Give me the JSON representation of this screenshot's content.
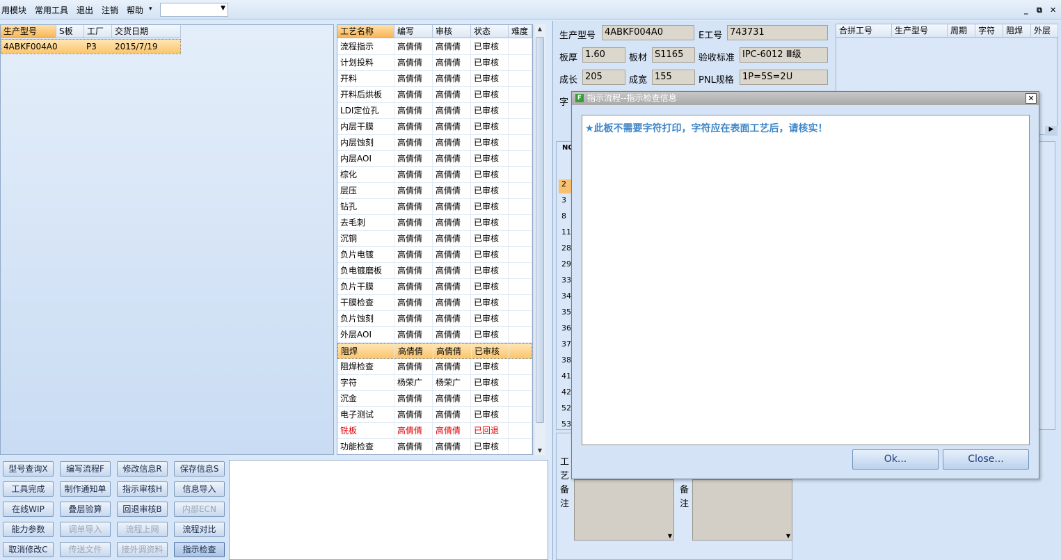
{
  "menubar": {
    "items": [
      "用模块",
      "常用工具",
      "退出",
      "注销",
      "帮助"
    ],
    "combo_value": "",
    "window_controls": [
      "_",
      "⧉",
      "✕"
    ]
  },
  "orders": {
    "columns": [
      "生产型号",
      "S板",
      "工厂",
      "交货日期"
    ],
    "rows": [
      {
        "model": "4ABKF004A0",
        "s": "",
        "factory": "P3",
        "date": "2015/7/19"
      }
    ]
  },
  "process": {
    "columns": [
      "工艺名称",
      "编写",
      "审核",
      "状态",
      "难度"
    ],
    "rows": [
      {
        "name": "流程指示",
        "writer": "高倩倩",
        "reviewer": "高倩倩",
        "status": "已审核"
      },
      {
        "name": "计划投料",
        "writer": "高倩倩",
        "reviewer": "高倩倩",
        "status": "已审核"
      },
      {
        "name": "开料",
        "writer": "高倩倩",
        "reviewer": "高倩倩",
        "status": "已审核"
      },
      {
        "name": "开料后烘板",
        "writer": "高倩倩",
        "reviewer": "高倩倩",
        "status": "已审核"
      },
      {
        "name": "LDI定位孔",
        "writer": "高倩倩",
        "reviewer": "高倩倩",
        "status": "已审核"
      },
      {
        "name": "内层干膜",
        "writer": "高倩倩",
        "reviewer": "高倩倩",
        "status": "已审核"
      },
      {
        "name": "内层蚀刻",
        "writer": "高倩倩",
        "reviewer": "高倩倩",
        "status": "已审核"
      },
      {
        "name": "内层AOI",
        "writer": "高倩倩",
        "reviewer": "高倩倩",
        "status": "已审核"
      },
      {
        "name": "棕化",
        "writer": "高倩倩",
        "reviewer": "高倩倩",
        "status": "已审核"
      },
      {
        "name": "层压",
        "writer": "高倩倩",
        "reviewer": "高倩倩",
        "status": "已审核"
      },
      {
        "name": "钻孔",
        "writer": "高倩倩",
        "reviewer": "高倩倩",
        "status": "已审核"
      },
      {
        "name": "去毛刺",
        "writer": "高倩倩",
        "reviewer": "高倩倩",
        "status": "已审核"
      },
      {
        "name": "沉铜",
        "writer": "高倩倩",
        "reviewer": "高倩倩",
        "status": "已审核"
      },
      {
        "name": "负片电镀",
        "writer": "高倩倩",
        "reviewer": "高倩倩",
        "status": "已审核"
      },
      {
        "name": "负电镀磨板",
        "writer": "高倩倩",
        "reviewer": "高倩倩",
        "status": "已审核"
      },
      {
        "name": "负片干膜",
        "writer": "高倩倩",
        "reviewer": "高倩倩",
        "status": "已审核"
      },
      {
        "name": "干膜检查",
        "writer": "高倩倩",
        "reviewer": "高倩倩",
        "status": "已审核"
      },
      {
        "name": "负片蚀刻",
        "writer": "高倩倩",
        "reviewer": "高倩倩",
        "status": "已审核"
      },
      {
        "name": "外层AOI",
        "writer": "高倩倩",
        "reviewer": "高倩倩",
        "status": "已审核"
      },
      {
        "name": "阻焊",
        "writer": "高倩倩",
        "reviewer": "高倩倩",
        "status": "已审核",
        "selected": true
      },
      {
        "name": "阻焊检查",
        "writer": "高倩倩",
        "reviewer": "高倩倩",
        "status": "已审核"
      },
      {
        "name": "字符",
        "writer": "杨荣广",
        "reviewer": "杨荣广",
        "status": "已审核"
      },
      {
        "name": "沉金",
        "writer": "高倩倩",
        "reviewer": "高倩倩",
        "status": "已审核"
      },
      {
        "name": "电子测试",
        "writer": "高倩倩",
        "reviewer": "高倩倩",
        "status": "已审核"
      },
      {
        "name": "铣板",
        "writer": "高倩倩",
        "reviewer": "高倩倩",
        "status": "已回退",
        "rejected": true
      },
      {
        "name": "功能检查",
        "writer": "高倩倩",
        "reviewer": "高倩倩",
        "status": "已审核"
      }
    ]
  },
  "buttons": [
    {
      "label": "型号查询X",
      "name": "model-query-button",
      "state": "normal"
    },
    {
      "label": "编写流程F",
      "name": "write-flow-button",
      "state": "normal"
    },
    {
      "label": "修改信息R",
      "name": "modify-info-button",
      "state": "normal"
    },
    {
      "label": "保存信息S",
      "name": "save-info-button",
      "state": "normal"
    },
    {
      "label": "工具完成",
      "name": "tool-complete-button",
      "state": "normal"
    },
    {
      "label": "制作通知单",
      "name": "make-notice-button",
      "state": "normal"
    },
    {
      "label": "指示审核H",
      "name": "instruction-review-button",
      "state": "normal"
    },
    {
      "label": "信息导入",
      "name": "info-import-button",
      "state": "normal"
    },
    {
      "label": "在线WIP",
      "name": "online-wip-button",
      "state": "normal"
    },
    {
      "label": "叠层验算",
      "name": "stackup-check-button",
      "state": "normal"
    },
    {
      "label": "回退审核B",
      "name": "rollback-review-button",
      "state": "normal"
    },
    {
      "label": "内部ECN",
      "name": "internal-ecn-button",
      "state": "disabled"
    },
    {
      "label": "能力参数",
      "name": "capability-params-button",
      "state": "normal"
    },
    {
      "label": "调单导入",
      "name": "order-import-button",
      "state": "disabled"
    },
    {
      "label": "流程上网",
      "name": "flow-online-button",
      "state": "disabled"
    },
    {
      "label": "流程对比",
      "name": "flow-compare-button",
      "state": "normal"
    },
    {
      "label": "取消修改C",
      "name": "cancel-modify-button",
      "state": "normal"
    },
    {
      "label": "传送文件",
      "name": "send-file-button",
      "state": "disabled"
    },
    {
      "label": "接外调资料",
      "name": "external-data-button",
      "state": "disabled"
    },
    {
      "label": "指示检查",
      "name": "instruction-check-button",
      "state": "active"
    }
  ],
  "info": {
    "model_label": "生产型号",
    "model_value": "4ABKF004A0",
    "eno_label": "E工号",
    "eno_value": "743731",
    "thick_label": "板厚",
    "thick_value": "1.60",
    "material_label": "板材",
    "material_value": "S1165",
    "standard_label": "验收标准",
    "standard_value": "IPC-6012 Ⅲ级",
    "length_label": "成长",
    "length_value": "205",
    "width_label": "成宽",
    "width_value": "155",
    "pnl_label": "PNL规格",
    "pnl_value": "1P=5S=2U",
    "char_label": "字"
  },
  "combine": {
    "columns": [
      "合拼工号",
      "生产型号",
      "周期",
      "字符",
      "阻焊",
      "外层"
    ]
  },
  "no_list": {
    "header": "NO",
    "values": [
      "2",
      "3",
      "8",
      "11",
      "28",
      "29",
      "33",
      "34",
      "35",
      "36",
      "37",
      "38",
      "41",
      "42",
      "52",
      "53"
    ]
  },
  "bottom": {
    "process_label": [
      "工",
      "艺"
    ],
    "note_label": [
      "备",
      "注"
    ],
    "note_label2": [
      "备",
      "注"
    ]
  },
  "dialog": {
    "title": "指示流程--指示检查信息",
    "message": "★此板不需要字符打印，字符应在表面工艺后，请核实！",
    "ok_label": "Ok...",
    "close_label": "Close..."
  }
}
